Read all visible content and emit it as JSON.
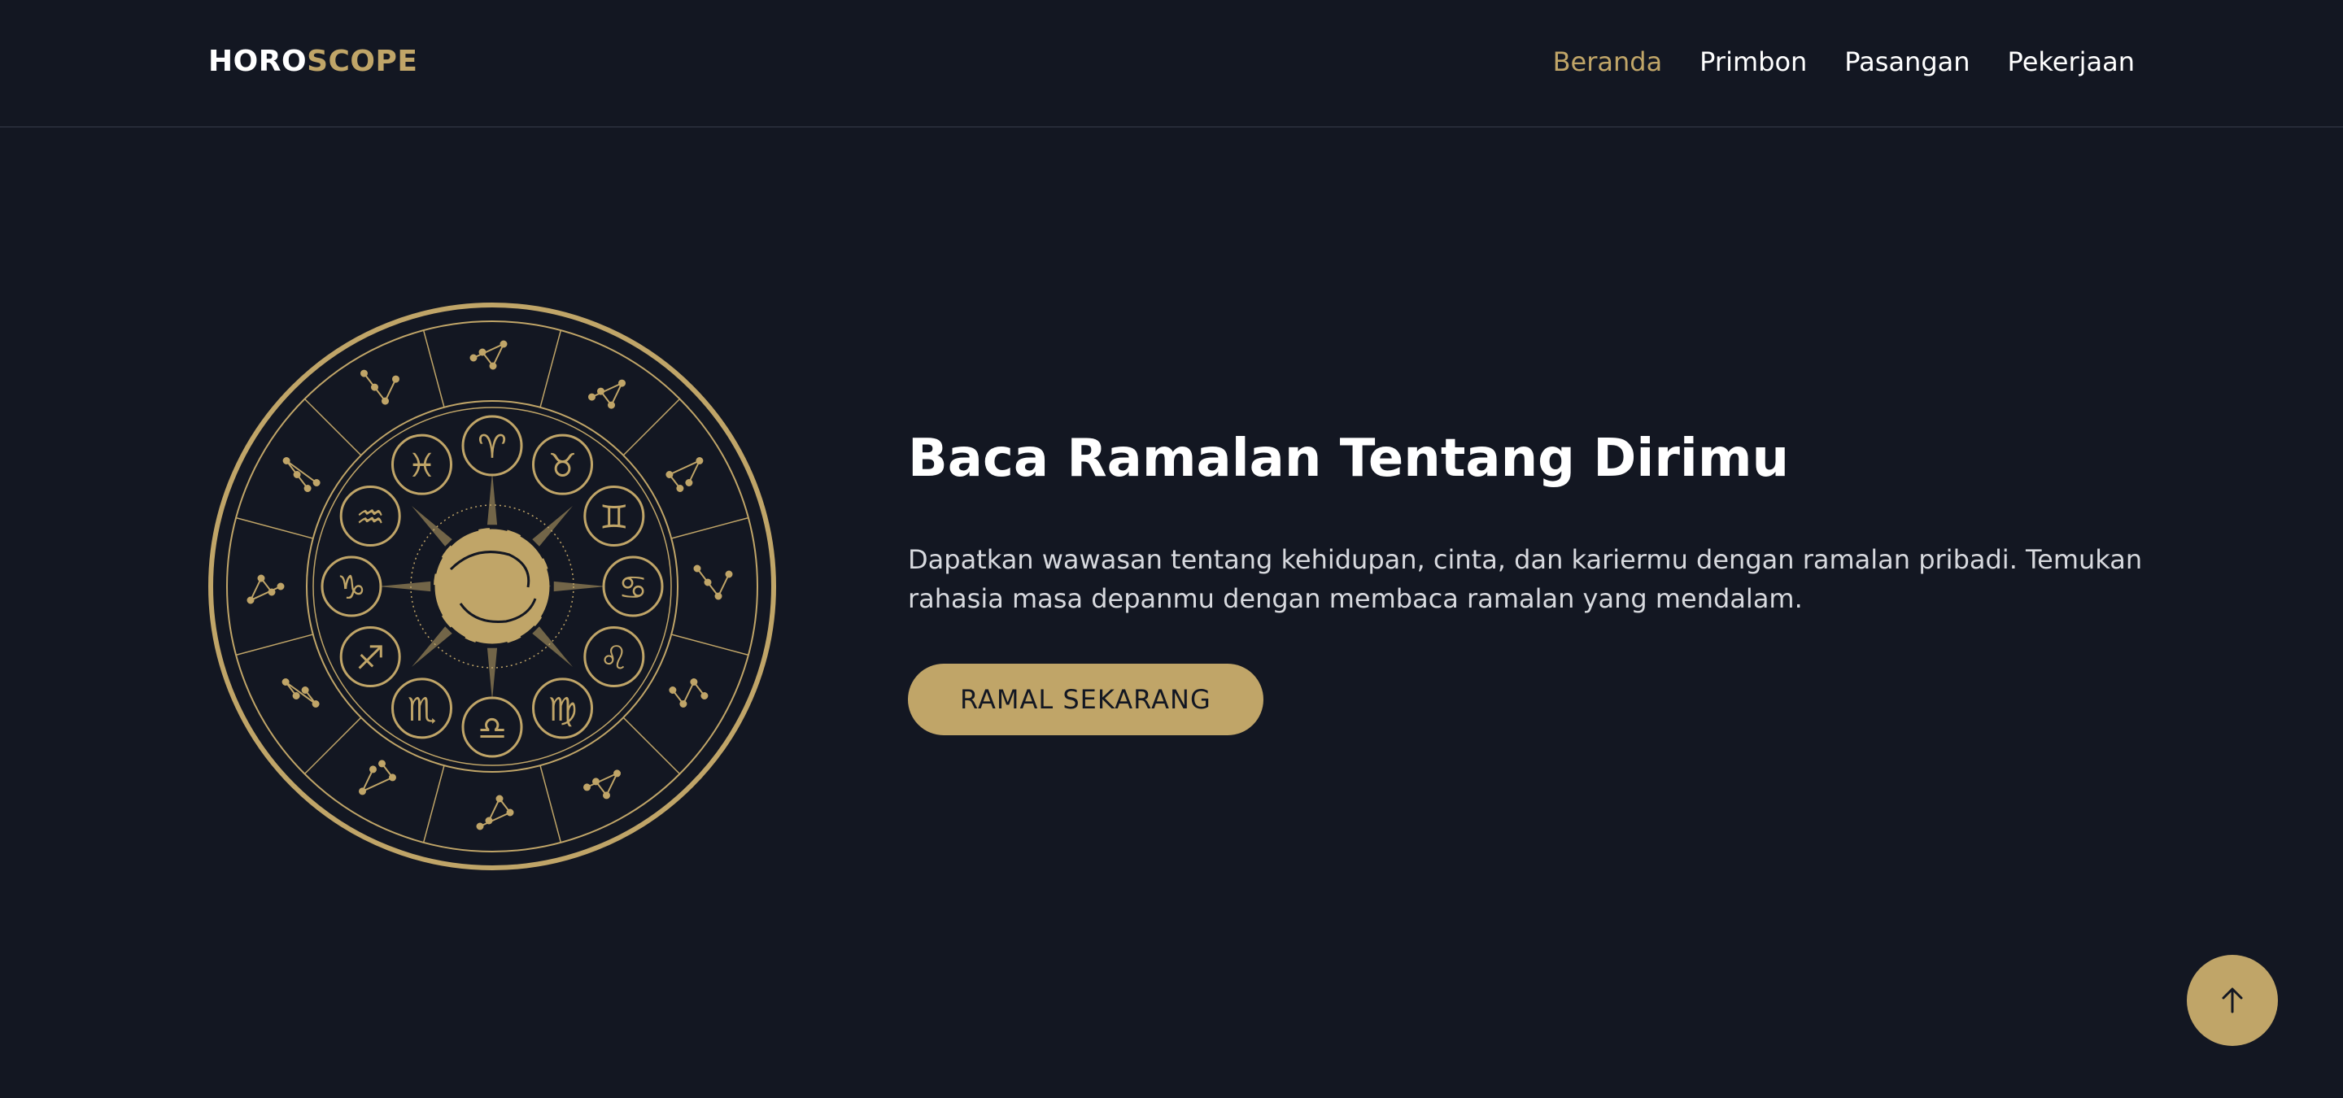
{
  "header": {
    "logo_part1": "HORO",
    "logo_part2": "SCOPE",
    "nav": [
      {
        "label": "Beranda",
        "active": true
      },
      {
        "label": "Primbon",
        "active": false
      },
      {
        "label": "Pasangan",
        "active": false
      },
      {
        "label": "Pekerjaan",
        "active": false
      }
    ]
  },
  "hero": {
    "title": "Baca Ramalan Tentang Dirimu",
    "description": "Dapatkan wawasan tentang kehidupan, cinta, dan kariermu dengan ramalan pribadi. Temukan rahasia masa depanmu dengan membaca ramalan yang mendalam.",
    "cta_label": "RAMAL SEKARANG",
    "illustration": "zodiac-wheel-icon"
  },
  "zodiac_symbols": [
    "♈",
    "♉",
    "♊",
    "♋",
    "♌",
    "♍",
    "♎",
    "♏",
    "♐",
    "♑",
    "♒",
    "♓"
  ],
  "scroll_top_icon": "arrow-up-icon",
  "colors": {
    "background": "#131722",
    "accent": "#c0a568",
    "text": "#ffffff",
    "muted_text": "#d7d9de",
    "divider": "#262b38"
  }
}
